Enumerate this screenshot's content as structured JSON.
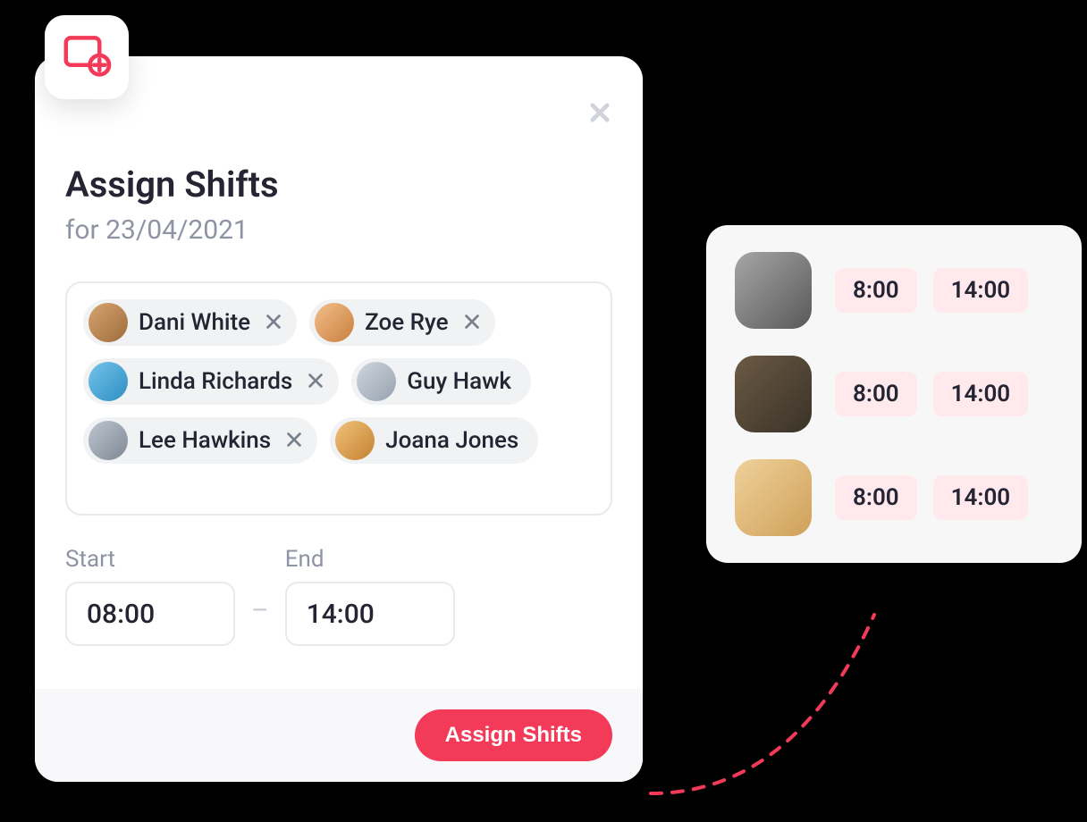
{
  "modal": {
    "title": "Assign Shifts",
    "subtitle": "for 23/04/2021",
    "people": [
      {
        "name": "Dani White",
        "removable": true,
        "avatar_class": "av1"
      },
      {
        "name": "Zoe Rye",
        "removable": true,
        "avatar_class": "av2"
      },
      {
        "name": "Linda Richards",
        "removable": true,
        "avatar_class": "av3"
      },
      {
        "name": "Guy Hawk",
        "removable": false,
        "avatar_class": "av4"
      },
      {
        "name": "Lee Hawkins",
        "removable": true,
        "avatar_class": "av5"
      },
      {
        "name": "Joana Jones",
        "removable": false,
        "avatar_class": "av6"
      }
    ],
    "start_label": "Start",
    "end_label": "End",
    "start_value": "08:00",
    "end_value": "14:00",
    "assign_button": "Assign Shifts"
  },
  "preview": {
    "rows": [
      {
        "avatar_class": "av7",
        "start": "8:00",
        "end": "14:00"
      },
      {
        "avatar_class": "av8",
        "start": "8:00",
        "end": "14:00"
      },
      {
        "avatar_class": "av9",
        "start": "8:00",
        "end": "14:00"
      }
    ]
  },
  "colors": {
    "accent": "#f43a59",
    "pill_bg": "#ffe9ed"
  }
}
